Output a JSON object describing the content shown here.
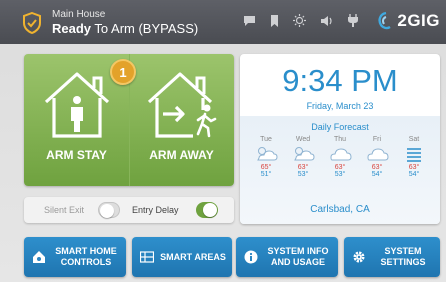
{
  "header": {
    "location": "Main House",
    "status_bold": "Ready",
    "status_rest": " To Arm (BYPASS)",
    "brand": "2GIG",
    "icons": [
      "message-icon",
      "bookmark-icon",
      "brightness-icon",
      "volume-icon",
      "plug-icon"
    ]
  },
  "arm": {
    "stay_label": "ARM STAY",
    "away_label": "ARM AWAY",
    "badge_count": "1"
  },
  "toggles": {
    "silent_exit": {
      "label": "Silent Exit",
      "on": false
    },
    "entry_delay": {
      "label": "Entry Delay",
      "on": true
    }
  },
  "weather": {
    "time": "9:34 PM",
    "date": "Friday, March 23",
    "forecast_title": "Daily Forecast",
    "days": [
      {
        "day": "Tue",
        "icon": "partly-cloudy-icon",
        "hi": "65°",
        "lo": "51°"
      },
      {
        "day": "Wed",
        "icon": "partly-cloudy-icon",
        "hi": "63°",
        "lo": "53°"
      },
      {
        "day": "Thu",
        "icon": "cloudy-icon",
        "hi": "63°",
        "lo": "53°"
      },
      {
        "day": "Fri",
        "icon": "cloudy-icon",
        "hi": "63°",
        "lo": "54°"
      },
      {
        "day": "Sat",
        "icon": "fog-icon",
        "hi": "63°",
        "lo": "54°"
      }
    ],
    "city": "Carlsbad, CA"
  },
  "buttons": {
    "smart_home": "SMART HOME CONTROLS",
    "smart_areas": "SMART AREAS",
    "system_info": "SYSTEM INFO AND USAGE",
    "system_settings": "SYSTEM SETTINGS"
  },
  "colors": {
    "header": "#55575d",
    "arm_green": "#7fb04c",
    "accent_blue": "#2a8ecb",
    "badge_orange": "#e3a22a",
    "temp_high": "#d9463f"
  }
}
